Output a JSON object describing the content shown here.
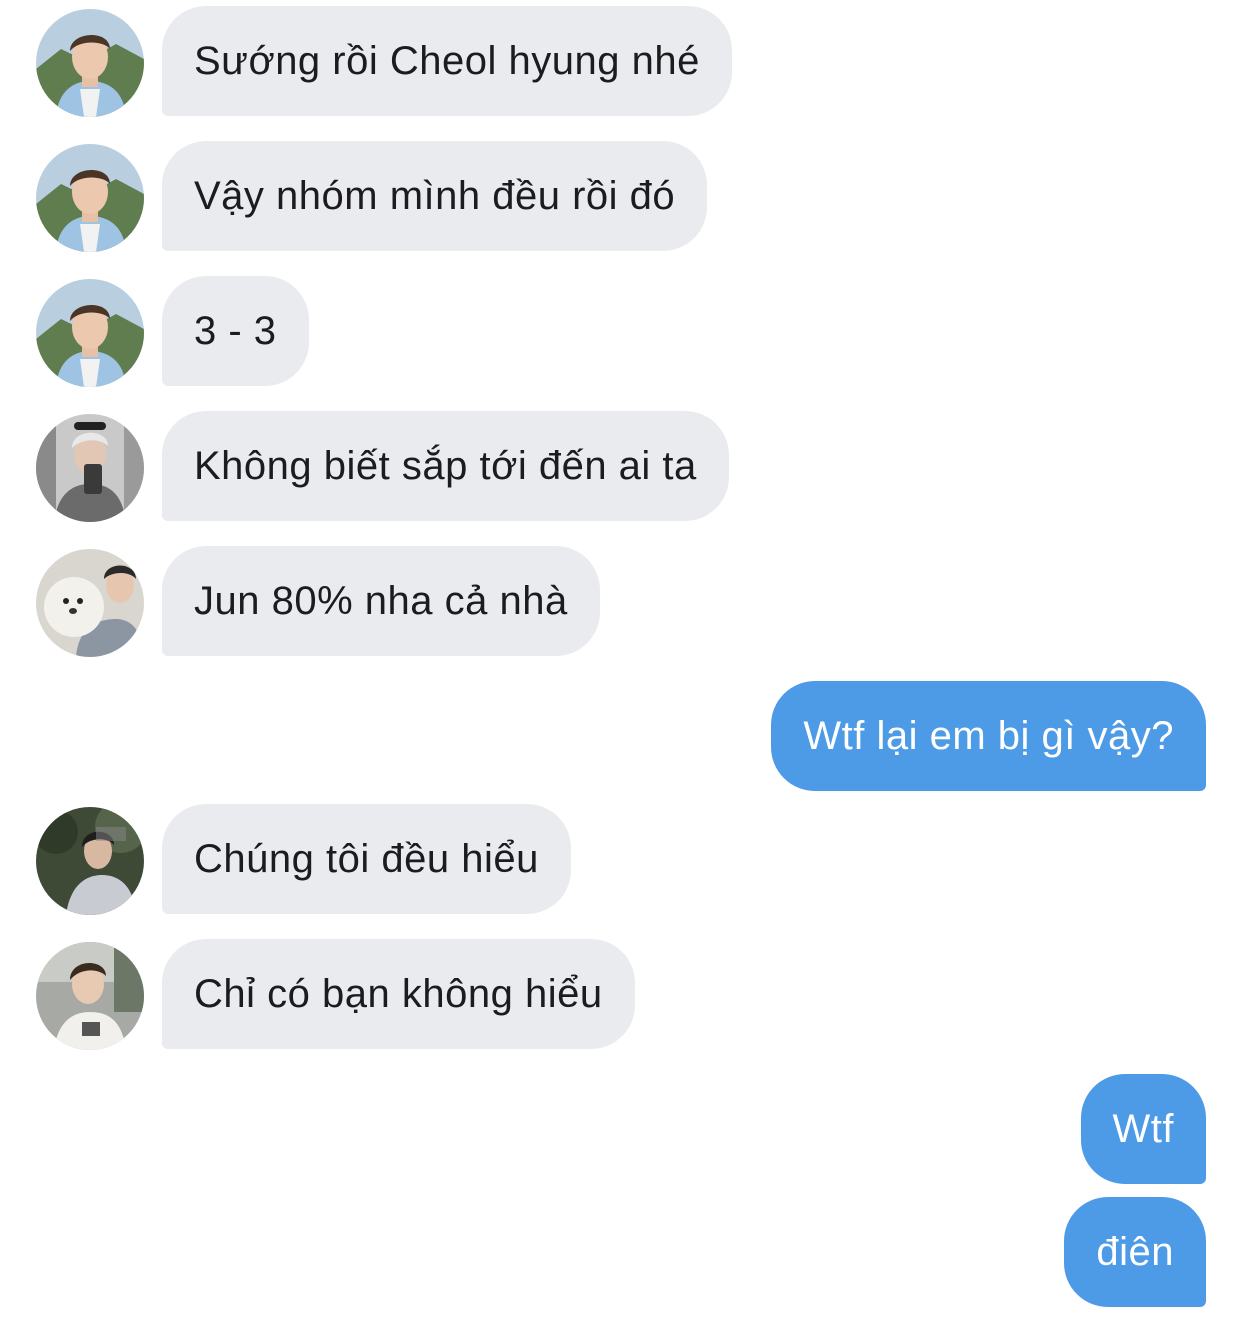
{
  "messages": [
    {
      "text": "Sướng rồi Cheol hyung nhé",
      "avatar": "avatar-boy-mountain"
    },
    {
      "text": "Vậy nhóm mình đều rồi đó",
      "avatar": "avatar-boy-mountain"
    },
    {
      "text": "3 - 3",
      "avatar": "avatar-boy-mountain"
    },
    {
      "text": "Không biết sắp tới đến ai ta",
      "avatar": "avatar-mirror-selfie"
    },
    {
      "text": "Jun 80% nha cả nhà",
      "avatar": "avatar-boy-dog"
    },
    {
      "text": "Wtf lại em bị gì vậy?"
    },
    {
      "text": "Chúng tôi đều hiểu",
      "avatar": "avatar-boy-trees"
    },
    {
      "text": "Chỉ có bạn không hiểu",
      "avatar": "avatar-boy-street"
    },
    {
      "text": "Wtf"
    },
    {
      "text": "điên"
    }
  ],
  "colors": {
    "incoming_bubble": "#e9ebef",
    "outgoing_bubble": "#4d9be6",
    "incoming_text": "#1c1c1e",
    "outgoing_text": "#ffffff"
  }
}
